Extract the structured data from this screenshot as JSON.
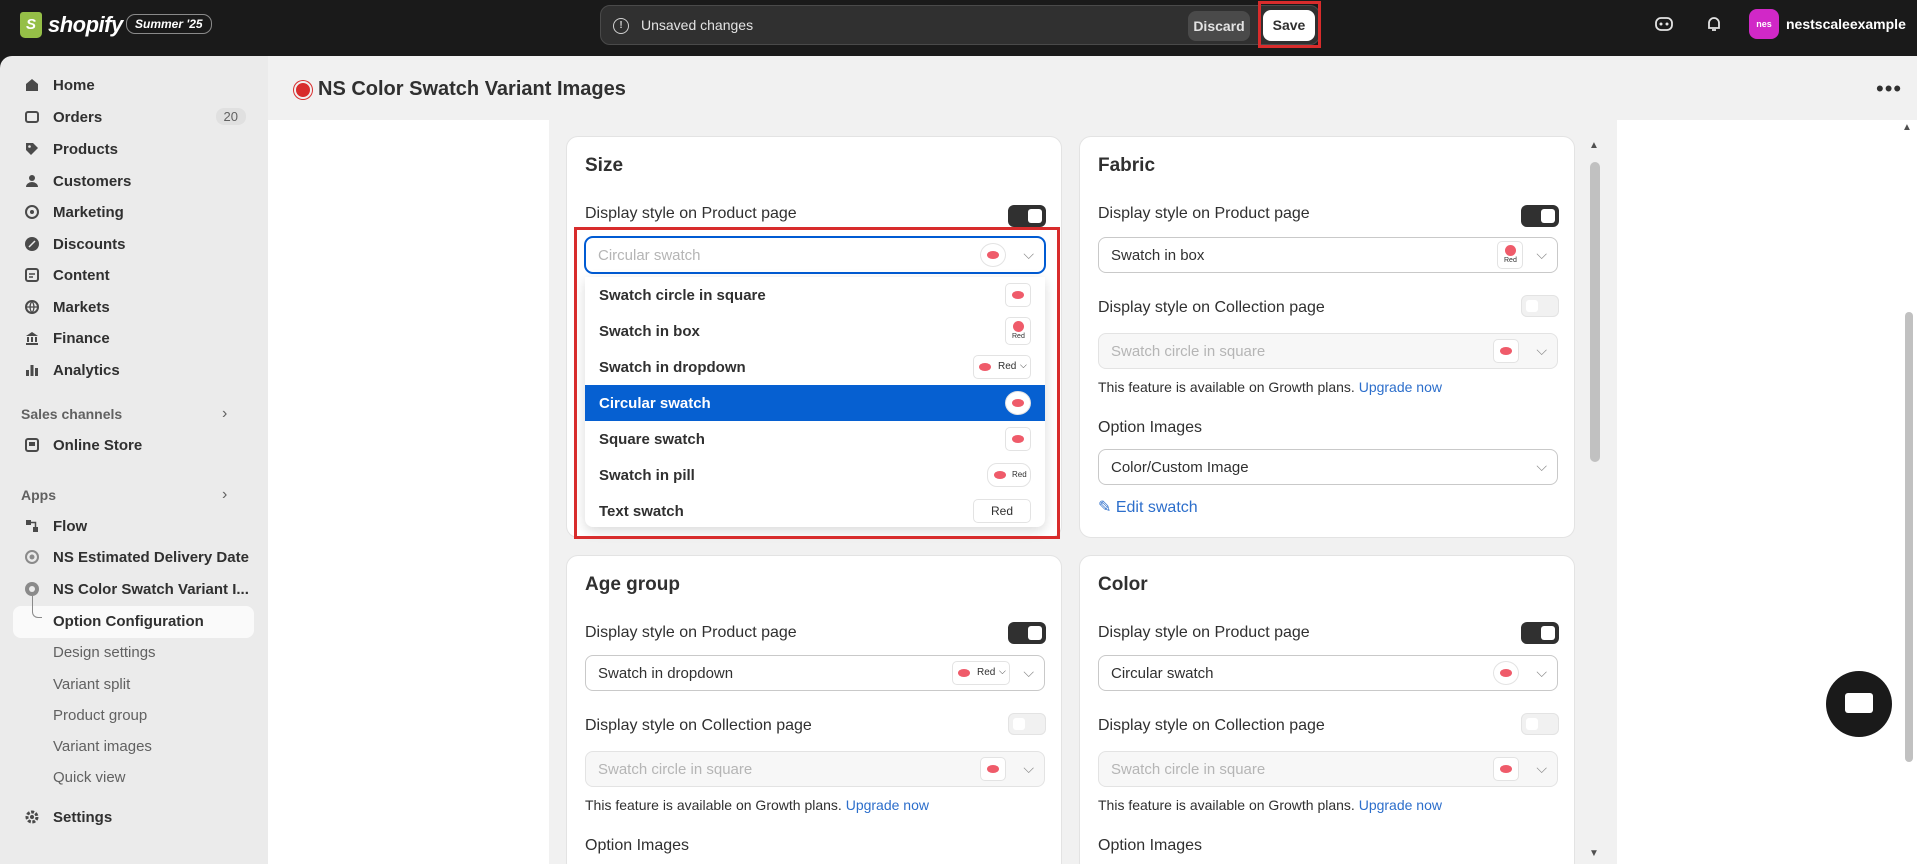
{
  "topbar": {
    "logo_text": "shopify",
    "badge": "Summer '25",
    "unsaved": "Unsaved changes",
    "discard": "Discard",
    "save": "Save",
    "avatar": "nes",
    "store": "nestscaleexample"
  },
  "sidebar": {
    "items": [
      {
        "label": "Home",
        "icon": "home-icon"
      },
      {
        "label": "Orders",
        "icon": "orders-icon",
        "count": "20"
      },
      {
        "label": "Products",
        "icon": "tag-icon"
      },
      {
        "label": "Customers",
        "icon": "person-icon"
      },
      {
        "label": "Marketing",
        "icon": "target-icon"
      },
      {
        "label": "Discounts",
        "icon": "discount-icon"
      },
      {
        "label": "Content",
        "icon": "content-icon"
      },
      {
        "label": "Markets",
        "icon": "globe-icon"
      },
      {
        "label": "Finance",
        "icon": "bank-icon"
      },
      {
        "label": "Analytics",
        "icon": "chart-icon"
      }
    ],
    "sales_channels": "Sales channels",
    "online_store": "Online Store",
    "apps": "Apps",
    "flow": "Flow",
    "ns_delivery": "NS Estimated Delivery Date",
    "ns_swatch": "NS Color Swatch Variant I...",
    "sub_items": [
      "Option Configuration",
      "Design settings",
      "Variant split",
      "Product group",
      "Variant images",
      "Quick view"
    ],
    "settings": "Settings"
  },
  "page": {
    "title": "NS Color Swatch Variant Images",
    "more": "•••"
  },
  "cards": {
    "size": {
      "title": "Size",
      "product_label": "Display style on Product page",
      "product_value": "Circular swatch"
    },
    "fabric": {
      "title": "Fabric",
      "product_label": "Display style on Product page",
      "product_value": "Swatch in box",
      "collection_label": "Display style on Collection page",
      "collection_value": "Swatch circle in square",
      "help": "This feature is available on Growth plans.",
      "upgrade": "Upgrade now",
      "option_images": "Option Images",
      "option_images_value": "Color/Custom Image",
      "edit_swatch": "Edit swatch"
    },
    "age": {
      "title": "Age group",
      "product_label": "Display style on Product page",
      "product_value": "Swatch in dropdown",
      "collection_label": "Display style on Collection page",
      "collection_value": "Swatch circle in square",
      "help": "This feature is available on Growth plans.",
      "upgrade": "Upgrade now",
      "option_images": "Option Images"
    },
    "color": {
      "title": "Color",
      "product_label": "Display style on Product page",
      "product_value": "Circular swatch",
      "collection_label": "Display style on Collection page",
      "collection_value": "Swatch circle in square",
      "help": "This feature is available on Growth plans.",
      "upgrade": "Upgrade now",
      "option_images": "Option Images"
    }
  },
  "dropdown": {
    "options": [
      "Swatch circle in square",
      "Swatch in box",
      "Swatch in dropdown",
      "Circular swatch",
      "Square swatch",
      "Swatch in pill",
      "Text swatch"
    ],
    "selected_index": 3,
    "swatch_text": "Red"
  },
  "colors": {
    "accent_blue": "#0660d1",
    "highlight_red": "#d82c2c",
    "swatch_red": "#ef5b6a"
  }
}
